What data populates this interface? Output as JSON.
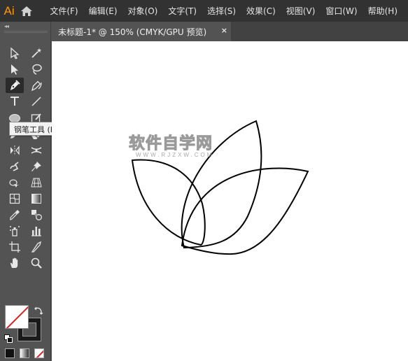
{
  "app": {
    "logo": "Ai",
    "home_icon": "home-icon"
  },
  "menu": [
    "文件(F)",
    "编辑(E)",
    "对象(O)",
    "文字(T)",
    "选择(S)",
    "效果(C)",
    "视图(V)",
    "窗口(W)",
    "帮助(H)"
  ],
  "document_tab": {
    "title": "未标题-1* @ 150% (CMYK/GPU 预览)",
    "close": "×"
  },
  "toolbox": {
    "collapse_label": "◂◂",
    "tooltip": "钢笔工具 (P)",
    "active_tool": "pen-tool",
    "tools": [
      "selection-tool",
      "magic-wand-tool",
      "direct-selection-tool",
      "lasso-tool",
      "pen-tool",
      "curvature-tool",
      "type-tool",
      "line-segment-tool",
      "ellipse-tool",
      "shaper-tool",
      "pencil-tool",
      "eraser-tool",
      "reflect-tool",
      "width-tool",
      "puppet-warp-tool",
      "pin-tool",
      "shape-builder-tool",
      "perspective-grid-tool",
      "mesh-tool",
      "gradient-tool",
      "eyedropper-tool",
      "blend-tool",
      "symbol-sprayer-tool",
      "column-graph-tool",
      "artboard-tool",
      "slice-tool",
      "hand-tool",
      "zoom-tool"
    ],
    "fill": "none",
    "stroke": "#000000"
  },
  "watermark": {
    "main": "软件自学网",
    "sub": "WWW.RJZXW.COM"
  }
}
